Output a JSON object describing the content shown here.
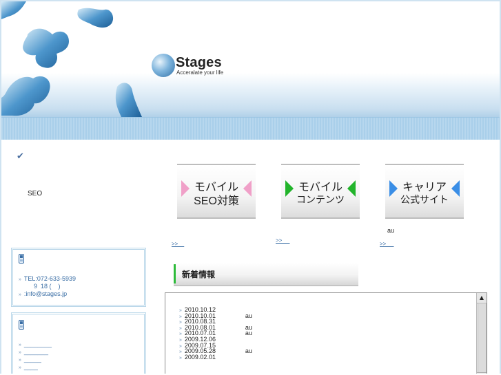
{
  "header": {
    "logo_name": "Stages",
    "tagline": "Acceralate your life"
  },
  "left": {
    "check_icon": "✔",
    "seo_text": "SEO",
    "contact": {
      "tel": "TEL:072-633-5939",
      "hours": "9  18 (    )",
      "email": ":info@stages.jp"
    },
    "links": [
      "________",
      "_______",
      "_____",
      "____"
    ]
  },
  "services": [
    {
      "line1": "モバイル",
      "line2": "SEO対策",
      "more": ">>    "
    },
    {
      "line1": "モバイル",
      "line2": "コンテンツ",
      "more": ">>     "
    },
    {
      "line1": "キャリア",
      "line2": "公式サイト",
      "more": ">>     "
    }
  ],
  "au_label": "au",
  "news": {
    "title": "新着情報",
    "items": [
      {
        "date": "2010.10.12",
        "text": ""
      },
      {
        "date": "2010.10.01",
        "text": "au"
      },
      {
        "date": "2010.08.31",
        "text": ""
      },
      {
        "date": "2010.08.01",
        "text": "au"
      },
      {
        "date": "2010.07.01",
        "text": "au"
      },
      {
        "date": "2009.12.06",
        "text": ""
      },
      {
        "date": "2009.07.15",
        "text": ""
      },
      {
        "date": "2009.05.28",
        "text": "au"
      },
      {
        "date": "2009.02.01",
        "text": ""
      }
    ]
  },
  "colors": {
    "accent_blue": "#3a6ea5",
    "service_pink": "#f0a0c8",
    "service_green": "#22b42b",
    "service_blue": "#3a8ee6",
    "news_green": "#2dbb3a"
  }
}
